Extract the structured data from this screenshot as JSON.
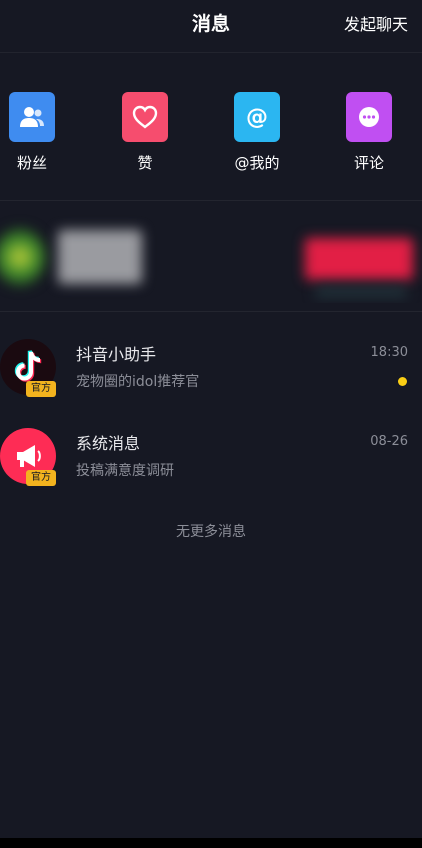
{
  "header": {
    "title": "消息",
    "start_chat": "发起聊天"
  },
  "quick_actions": [
    {
      "label": "粉丝",
      "icon": "fans-icon",
      "color": "#3f8cf0"
    },
    {
      "label": "赞",
      "icon": "heart-icon",
      "color": "#f64d6e"
    },
    {
      "label": "@我的",
      "icon": "at-icon",
      "color": "#2bb6f1"
    },
    {
      "label": "评论",
      "icon": "comment-icon",
      "color": "#c04ff2"
    }
  ],
  "messages": [
    {
      "title": "抖音小助手",
      "subtitle": "宠物圈的idol推荐官",
      "time": "18:30",
      "badge": "官方",
      "unread": true,
      "icon": "tiktok-logo-icon"
    },
    {
      "title": "系统消息",
      "subtitle": "投稿满意度调研",
      "time": "08-26",
      "badge": "官方",
      "unread": false,
      "icon": "megaphone-icon"
    }
  ],
  "footer_text": "无更多消息",
  "colors": {
    "background": "#161823",
    "accent": "#fe2c55",
    "unread_dot": "#face15"
  }
}
